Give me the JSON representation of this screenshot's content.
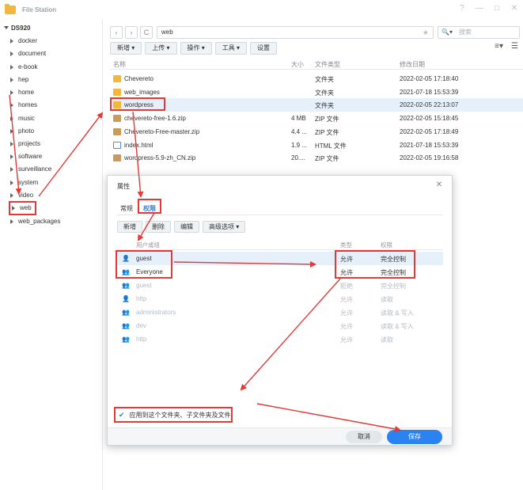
{
  "app": {
    "title": "File Station",
    "controls": [
      "?",
      "—",
      "□",
      "✕"
    ]
  },
  "sidebar": {
    "root": "DS920",
    "items": [
      "docker",
      "document",
      "e-book",
      "hep",
      "home",
      "homes",
      "music",
      "photo",
      "projects",
      "software",
      "surveillance",
      "system",
      "video",
      "web",
      "web_packages"
    ],
    "selected": "web"
  },
  "toolbar": {
    "back": "‹",
    "forward": "›",
    "refresh": "C",
    "path": "web",
    "search_placeholder": "搜索",
    "buttons": [
      "新增 ▾",
      "上传 ▾",
      "操作 ▾",
      "工具 ▾",
      "设置"
    ]
  },
  "filelist": {
    "columns": [
      "名称",
      "大小",
      "文件类型",
      "修改日期"
    ],
    "rows": [
      {
        "name": "Chevereto",
        "size": "",
        "type": "文件夹",
        "date": "2022-02-05 17:18:40",
        "icon": "folder"
      },
      {
        "name": "web_images",
        "size": "",
        "type": "文件夹",
        "date": "2021-07-18 15:53:39",
        "icon": "folder"
      },
      {
        "name": "wordpress",
        "size": "",
        "type": "文件夹",
        "date": "2022-02-05 22:13:07",
        "icon": "folder"
      },
      {
        "name": "chevereto-free-1.6.zip",
        "size": "4 MB",
        "type": "ZIP 文件",
        "date": "2022-02-05 15:18:45",
        "icon": "zip"
      },
      {
        "name": "Chevereto-Free-master.zip",
        "size": "4.4 ...",
        "type": "ZIP 文件",
        "date": "2022-02-05 17:18:49",
        "icon": "zip"
      },
      {
        "name": "index.html",
        "size": "1.9 ...",
        "type": "HTML 文件",
        "date": "2021-07-18 15:53:39",
        "icon": "html"
      },
      {
        "name": "wordpress-5.9-zh_CN.zip",
        "size": "20....",
        "type": "ZIP 文件",
        "date": "2022-02-05 19:16:58",
        "icon": "zip"
      }
    ]
  },
  "dialog": {
    "title": "属性",
    "close": "✕",
    "tabs": [
      "常规",
      "权限"
    ],
    "buttons": [
      "新增",
      "删除",
      "编辑",
      "高级选项 ▾"
    ],
    "columns": [
      "用户或组",
      "类型",
      "权限"
    ],
    "rows": [
      {
        "icon": "user",
        "name": "guest",
        "type": "允许",
        "perm": "完全控制",
        "dim": false
      },
      {
        "icon": "group",
        "name": "Everyone",
        "type": "允许",
        "perm": "完全控制",
        "dim": false
      },
      {
        "icon": "group",
        "name": "guest",
        "type": "拒绝",
        "perm": "完全控制",
        "dim": true
      },
      {
        "icon": "user",
        "name": "http",
        "type": "允许",
        "perm": "读取",
        "dim": true
      },
      {
        "icon": "group",
        "name": "administrators",
        "type": "允许",
        "perm": "读取 & 写入",
        "dim": true
      },
      {
        "icon": "group",
        "name": "dev",
        "type": "允许",
        "perm": "读取 & 写入",
        "dim": true
      },
      {
        "icon": "group",
        "name": "http",
        "type": "允许",
        "perm": "读取",
        "dim": true
      }
    ],
    "apply_label": "应用到这个文件夹、子文件夹及文件",
    "cancel": "取消",
    "save": "保存"
  },
  "colors": {
    "accent": "#2a83f0",
    "annotation": "#e53935",
    "folder": "#f3b73b"
  }
}
